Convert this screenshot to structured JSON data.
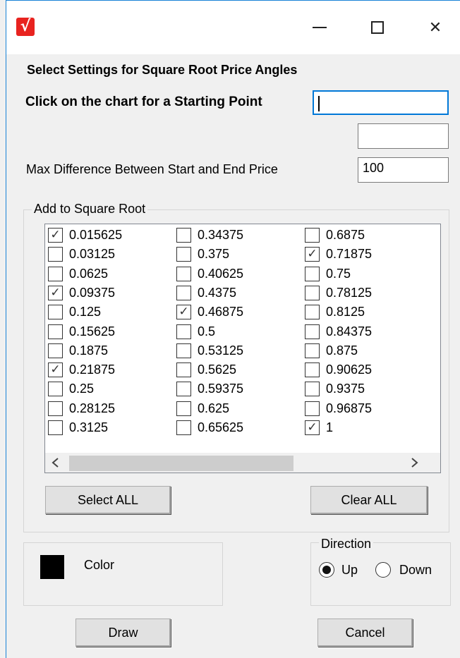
{
  "window": {
    "icon_glyph": "√",
    "controls": {
      "minimize": "minimize-icon",
      "maximize": "maximize-icon",
      "close_glyph": "✕"
    }
  },
  "heading": "Select Settings for Square Root Price Angles",
  "start_point": {
    "label": "Click on the chart for a Starting Point",
    "value": "",
    "value2": ""
  },
  "max_diff": {
    "label": "Max Difference Between Start and End Price",
    "value": "100"
  },
  "square_root_group": {
    "title": "Add to Square Root",
    "columns": [
      [
        {
          "label": "0.015625",
          "checked": true
        },
        {
          "label": "0.03125",
          "checked": false
        },
        {
          "label": "0.0625",
          "checked": false
        },
        {
          "label": "0.09375",
          "checked": true
        },
        {
          "label": "0.125",
          "checked": false
        },
        {
          "label": "0.15625",
          "checked": false
        },
        {
          "label": "0.1875",
          "checked": false
        },
        {
          "label": "0.21875",
          "checked": true
        },
        {
          "label": "0.25",
          "checked": false
        },
        {
          "label": "0.28125",
          "checked": false
        },
        {
          "label": "0.3125",
          "checked": false
        }
      ],
      [
        {
          "label": "0.34375",
          "checked": false
        },
        {
          "label": "0.375",
          "checked": false
        },
        {
          "label": "0.40625",
          "checked": false
        },
        {
          "label": "0.4375",
          "checked": false
        },
        {
          "label": "0.46875",
          "checked": true
        },
        {
          "label": "0.5",
          "checked": false
        },
        {
          "label": "0.53125",
          "checked": false
        },
        {
          "label": "0.5625",
          "checked": false
        },
        {
          "label": "0.59375",
          "checked": false
        },
        {
          "label": "0.625",
          "checked": false
        },
        {
          "label": "0.65625",
          "checked": false
        }
      ],
      [
        {
          "label": "0.6875",
          "checked": false
        },
        {
          "label": "0.71875",
          "checked": true
        },
        {
          "label": "0.75",
          "checked": false
        },
        {
          "label": "0.78125",
          "checked": false
        },
        {
          "label": "0.8125",
          "checked": false
        },
        {
          "label": "0.84375",
          "checked": false
        },
        {
          "label": "0.875",
          "checked": false
        },
        {
          "label": "0.90625",
          "checked": false
        },
        {
          "label": "0.9375",
          "checked": false
        },
        {
          "label": "0.96875",
          "checked": false
        },
        {
          "label": "1",
          "checked": true
        }
      ]
    ],
    "check_glyph": "✓",
    "select_all": "Select ALL",
    "clear_all": "Clear ALL"
  },
  "color": {
    "label": "Color",
    "value": "#000000"
  },
  "direction": {
    "title": "Direction",
    "up": "Up",
    "down": "Down",
    "selected": "Up"
  },
  "actions": {
    "draw": "Draw",
    "cancel": "Cancel"
  }
}
